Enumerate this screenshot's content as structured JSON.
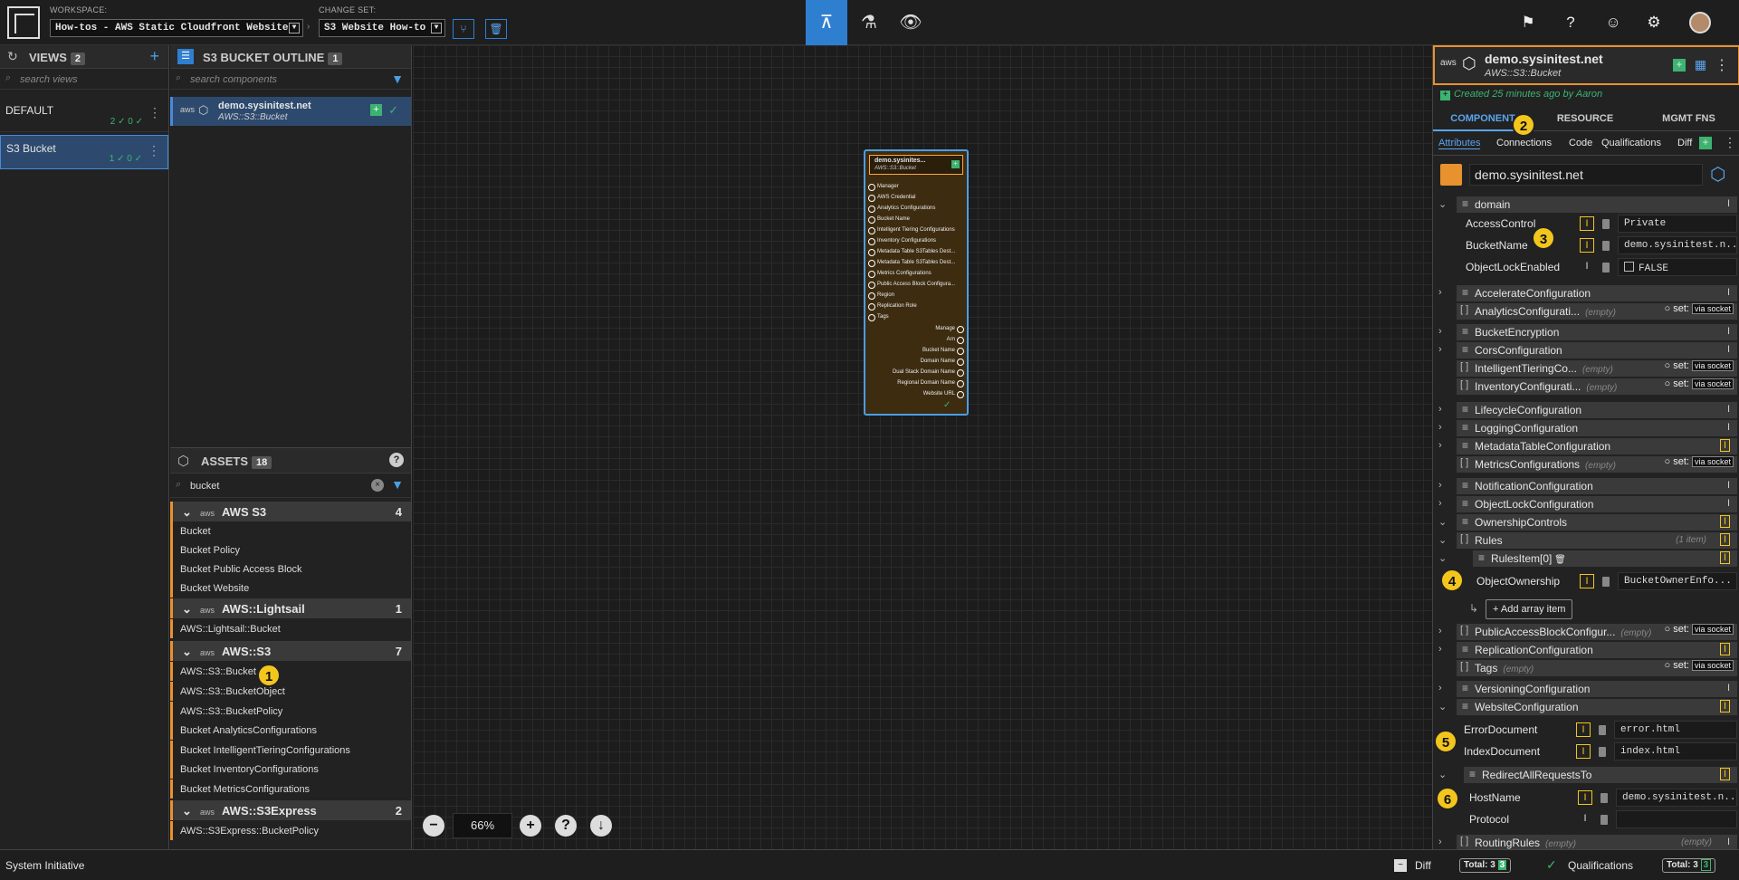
{
  "topbar": {
    "workspace_label": "WORKSPACE:",
    "workspace_value": "How-tos - AWS Static Cloudfront Website",
    "changeset_label": "CHANGE SET:",
    "changeset_value": "S3 Website How-to"
  },
  "views": {
    "title": "VIEWS",
    "count": "2",
    "search_placeholder": "search views",
    "items": [
      {
        "name": "DEFAULT",
        "counts": "2 ✓ 0 ✓"
      },
      {
        "name": "S3 Bucket",
        "counts": "1 ✓ 0 ✓"
      }
    ]
  },
  "outline": {
    "title": "S3 BUCKET OUTLINE",
    "count": "1",
    "search_placeholder": "search components",
    "component": {
      "name": "demo.sysinitest.net",
      "type": "AWS::S3::Bucket"
    }
  },
  "assets": {
    "title": "ASSETS",
    "count": "18",
    "search_value": "bucket",
    "groups": [
      {
        "name": "AWS S3",
        "count": "4",
        "items": [
          "Bucket",
          "Bucket Policy",
          "Bucket Public Access Block",
          "Bucket Website"
        ]
      },
      {
        "name": "AWS::Lightsail",
        "count": "1",
        "items": [
          "AWS::Lightsail::Bucket"
        ]
      },
      {
        "name": "AWS::S3",
        "count": "7",
        "items": [
          "AWS::S3::Bucket",
          "AWS::S3::BucketObject",
          "AWS::S3::BucketPolicy",
          "Bucket AnalyticsConfigurations",
          "Bucket IntelligentTieringConfigurations",
          "Bucket InventoryConfigurations",
          "Bucket MetricsConfigurations"
        ]
      },
      {
        "name": "AWS::S3Express",
        "count": "2",
        "items": [
          "AWS::S3Express::BucketPolicy"
        ]
      }
    ]
  },
  "node": {
    "title": "demo.sysinites...",
    "type": "AWS::S3::Bucket",
    "inputs": [
      "Manager",
      "AWS Credential",
      "Analytics Configurations",
      "Bucket Name",
      "Intelligent Tiering Configurations",
      "Inventory Configurations",
      "Metadata Table S3Tables Dest...",
      "Metadata Table S3Tables Dest...",
      "Metrics Configurations",
      "Public Access Block Configura...",
      "Region",
      "Replication Role",
      "Tags"
    ],
    "outputs": [
      "Manage",
      "Arn",
      "Bucket Name",
      "Domain Name",
      "Dual Stack Domain Name",
      "Regional Domain Name",
      "Website URL"
    ]
  },
  "zoom": {
    "level": "66%"
  },
  "right": {
    "name": "demo.sysinitest.net",
    "type": "AWS::S3::Bucket",
    "created": "Created 25 minutes ago by Aaron",
    "tabs": [
      "COMPONENT",
      "RESOURCE",
      "MGMT FNS"
    ],
    "subtabs": [
      "Attributes",
      "Connections",
      "Code",
      "Qualifications",
      "Diff"
    ],
    "name_value": "demo.sysinitest.net",
    "domain": "domain",
    "props": {
      "access_control": {
        "label": "AccessControl",
        "value": "Private"
      },
      "bucket_name": {
        "label": "BucketName",
        "value": "demo.sysinitest.n..."
      },
      "object_lock": {
        "label": "ObjectLockEnabled",
        "value": "FALSE"
      }
    },
    "groups": [
      "AccelerateConfiguration",
      "AnalyticsConfigurati...",
      "BucketEncryption",
      "CorsConfiguration",
      "IntelligentTieringCo...",
      "InventoryConfigurati...",
      "LifecycleConfiguration",
      "LoggingConfiguration",
      "MetadataTableConfiguration",
      "MetricsConfigurations",
      "NotificationConfiguration",
      "ObjectLockConfiguration",
      "OwnershipControls",
      "Rules",
      "RulesItem[0]",
      "PublicAccessBlockConfigur...",
      "ReplicationConfiguration",
      "Tags",
      "VersioningConfiguration",
      "WebsiteConfiguration",
      "RedirectAllRequestsTo",
      "RoutingRules"
    ],
    "empty_label": "(empty)",
    "one_item": "(1 item)",
    "set_label": "set:",
    "via_socket": "via socket",
    "object_ownership": {
      "label": "ObjectOwnership",
      "value": "BucketOwnerEnfo..."
    },
    "add_array_item": "+ Add array item",
    "error_document": {
      "label": "ErrorDocument",
      "value": "error.html"
    },
    "index_document": {
      "label": "IndexDocument",
      "value": "index.html"
    },
    "host_name": {
      "label": "HostName",
      "value": "demo.sysinitest.n..."
    },
    "protocol": {
      "label": "Protocol",
      "value": ""
    }
  },
  "status": {
    "app": "System Initiative",
    "diff": "Diff",
    "diff_total": "Total: 3",
    "diff_count": "3",
    "qual": "Qualifications",
    "qual_total": "Total: 3",
    "qual_count": "3"
  },
  "callouts": [
    "1",
    "2",
    "3",
    "4",
    "5",
    "6"
  ]
}
